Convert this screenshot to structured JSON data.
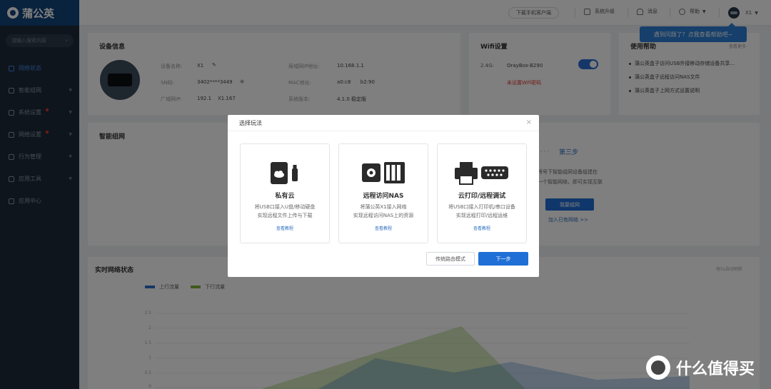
{
  "app": {
    "name": "蒲公英"
  },
  "sidebar": {
    "search_placeholder": "请输入搜索内容",
    "items": [
      {
        "label": "网络状态",
        "active": true
      },
      {
        "label": "智能组网",
        "has_arrow": true
      },
      {
        "label": "系统设置",
        "has_arrow": true,
        "badge": true
      },
      {
        "label": "网络设置",
        "has_arrow": true,
        "badge": true
      },
      {
        "label": "行为管理",
        "has_arrow": true
      },
      {
        "label": "应用工具",
        "has_arrow": true
      },
      {
        "label": "应用中心"
      }
    ]
  },
  "topbar": {
    "download_app": "下载手机客户端",
    "upgrade": "系统升级",
    "messages": "消息",
    "help": "帮助",
    "user": "X1"
  },
  "tooltip": {
    "text": "遇到问题了？点我查看帮助吧~"
  },
  "device_info": {
    "title": "设备信息",
    "name_label": "设备名称:",
    "name_value": "X1",
    "sn_label": "SN码:",
    "sn_value": "3402****3449",
    "wan_label": "广域网IP:",
    "wan_value": "192.1    X1.167",
    "lan_label": "局域网IP地址:",
    "lan_value": "10.168.1.1",
    "mac_label": "MAC地址:",
    "mac_value": "a0:c8      b2:90",
    "version_label": "系统版本:",
    "version_value": "4.1.0 稳定版"
  },
  "wifi": {
    "title": "Wifi设置",
    "band": "2.4G:",
    "ssid": "OrayBox-B290",
    "warning": "未设置Wifi密码",
    "enabled": true
  },
  "help": {
    "title": "使用帮助",
    "more": "查看更多",
    "items": [
      "蒲公英盒子访问USB外接移动存储设备共享...",
      "蒲公英盒子远程访问NAS文件",
      "蒲公英盒子上网方式设置说明"
    ]
  },
  "smart_net": {
    "title": "智能组网",
    "step3": "第三步",
    "desc_line1": "将号下智能组网设备组建在",
    "desc_line2": "一个智能网络，即可实现互联",
    "join_btn": "我要组网",
    "join_link": "加入已有网络 >>"
  },
  "realtime": {
    "title": "实时网络状态",
    "refresh": "每5s自动刷新",
    "legend_up": "上行流量",
    "legend_down": "下行流量",
    "up_color": "#2c6fc4",
    "down_color": "#7fb63a",
    "y_ticks": [
      "2.5",
      "2",
      "1.5",
      "1",
      "0.5",
      "0"
    ]
  },
  "modal": {
    "title": "选择玩法",
    "options": [
      {
        "title": "私有云",
        "desc1": "将USB口接入U盘/移动硬盘",
        "desc2": "实现远程文件上传与下载",
        "link": "查看教程"
      },
      {
        "title": "远程访问NAS",
        "desc1": "将蒲公英X1接入网络",
        "desc2": "实现远程访问NAS上的资源",
        "link": "查看教程"
      },
      {
        "title": "云打印/远程调试",
        "desc1": "将USB口接入打印机/串口设备",
        "desc2": "实现远程打印/远程运维",
        "link": "查看教程"
      }
    ],
    "btn_traditional": "传统路由模式",
    "btn_next": "下一步"
  },
  "watermark": {
    "text": "什么值得买"
  }
}
